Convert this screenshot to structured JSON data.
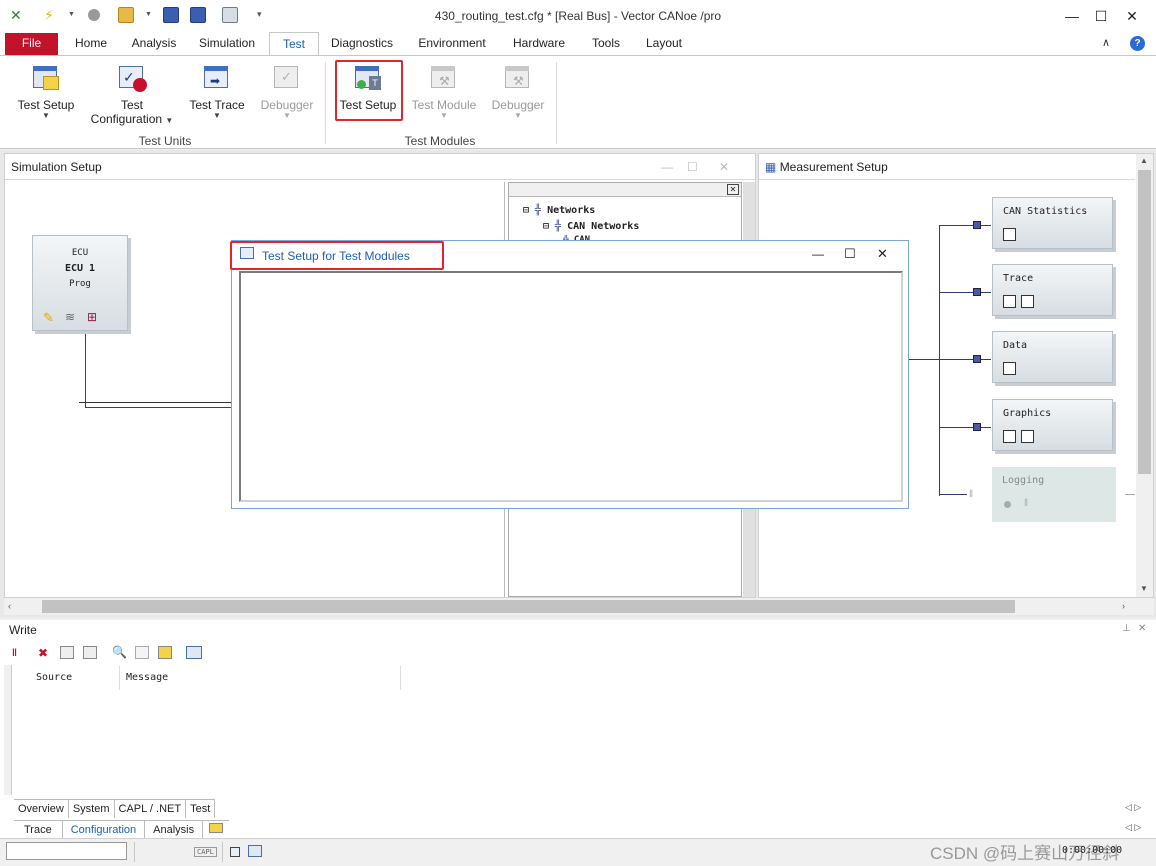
{
  "window": {
    "title": "430_routing_test.cfg * [Real Bus] - Vector CANoe /pro",
    "minimize": "—",
    "maximize": "☐",
    "close": "✕"
  },
  "quick_access": [
    "app-icon",
    "lightning-icon",
    "record-icon",
    "open-folder-icon",
    "save-icon",
    "save-as-icon",
    "config-icon"
  ],
  "ribbon_tabs": {
    "file": "File",
    "home": "Home",
    "analysis": "Analysis",
    "simulation": "Simulation",
    "test": "Test",
    "diagnostics": "Diagnostics",
    "environment": "Environment",
    "hardware": "Hardware",
    "tools": "Tools",
    "layout": "Layout"
  },
  "ribbon": {
    "test_units": {
      "group_label": "Test Units",
      "test_setup": "Test Setup",
      "test_configuration_1": "Test",
      "test_configuration_2": "Configuration",
      "test_trace": "Test Trace",
      "debugger": "Debugger"
    },
    "test_modules": {
      "group_label": "Test Modules",
      "test_setup": "Test Setup",
      "test_module": "Test Module",
      "debugger": "Debugger"
    }
  },
  "simulation_setup": {
    "title": "Simulation Setup",
    "ecu": {
      "type": "ECU",
      "name": "ECU 1",
      "mode": "Prog"
    },
    "tree": {
      "networks": "Networks",
      "can_networks": "CAN Networks",
      "can": "CAN"
    }
  },
  "measurement_setup": {
    "title": "Measurement Setup",
    "blocks": [
      "CAN Statistics",
      "Trace",
      "Data",
      "Graphics",
      "Logging"
    ]
  },
  "dialog": {
    "title": "Test Setup for Test Modules",
    "minimize": "—",
    "maximize": "☐",
    "close": "✕"
  },
  "write": {
    "title": "Write",
    "pin": "⊥",
    "close": "✕",
    "columns": [
      "Source",
      "Message"
    ],
    "tabs": [
      "Overview",
      "System",
      "CAPL / .NET",
      "Test"
    ]
  },
  "bottom_tabs": [
    "Trace",
    "Configuration",
    "Analysis"
  ],
  "status": {
    "time": "0:00:00:00",
    "capl": "CAPL"
  },
  "watermark": "CSDN @码上赛山万径斜",
  "colors": {
    "accent": "#1a5fb4",
    "file_tab": "#c2132b",
    "highlight": "#e0252c"
  }
}
